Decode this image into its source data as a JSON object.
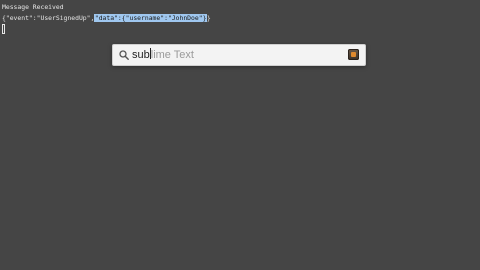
{
  "terminal": {
    "heading": "Message Received",
    "json_prefix": "{\"event\":\"UserSignedUp\",",
    "json_selected": "\"data\":{\"username\":\"JohnDoe\"}",
    "json_suffix": "}"
  },
  "spotlight": {
    "typed": "sub",
    "completion": "lime Text",
    "app_icon": "sublime-text-app-icon",
    "search_icon": "search-icon"
  },
  "colors": {
    "background": "#454545",
    "selection": "#9fc7ef",
    "spotlight_bg": "#f3f3f3"
  }
}
